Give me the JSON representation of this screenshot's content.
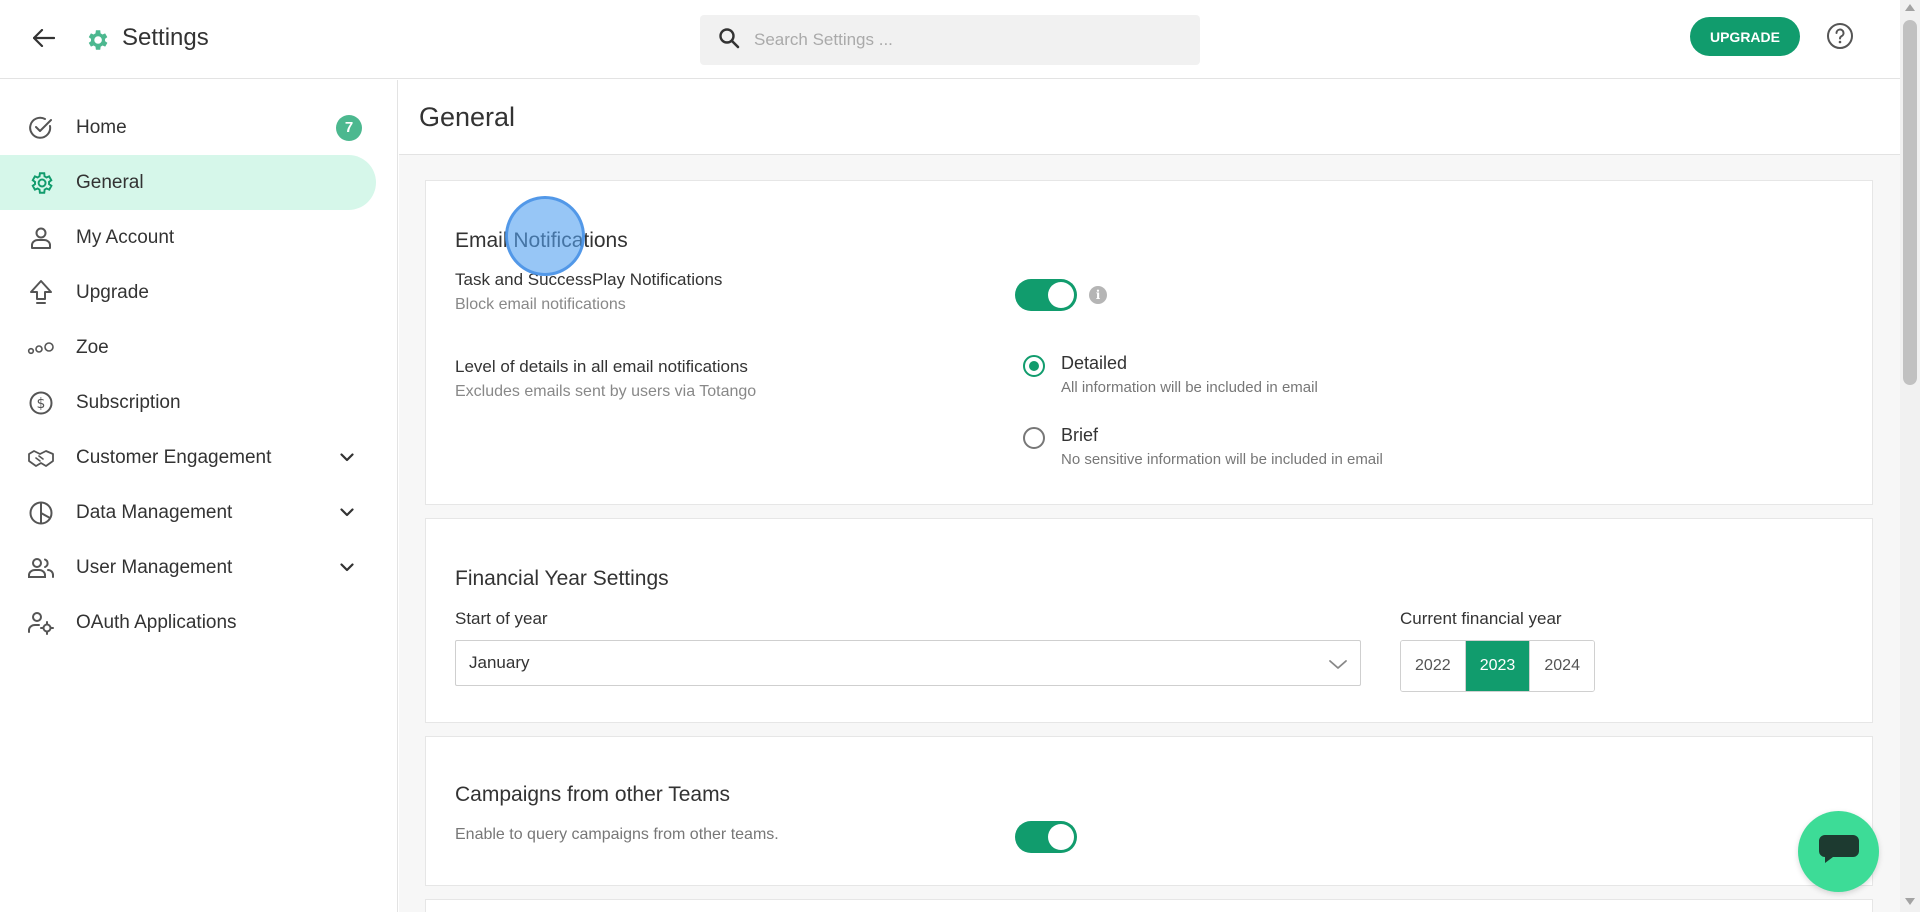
{
  "header": {
    "title": "Settings",
    "search_placeholder": "Search Settings ...",
    "upgrade_label": "UPGRADE"
  },
  "sidebar": {
    "items": [
      {
        "label": "Home",
        "icon": "check-circle-icon",
        "badge": "7"
      },
      {
        "label": "General",
        "icon": "gear-icon",
        "active": true
      },
      {
        "label": "My Account",
        "icon": "person-icon"
      },
      {
        "label": "Upgrade",
        "icon": "upgrade-arrow-icon"
      },
      {
        "label": "Zoe",
        "icon": "dots-icon"
      },
      {
        "label": "Subscription",
        "icon": "dollar-circle-icon"
      },
      {
        "label": "Customer Engagement",
        "icon": "handshake-icon",
        "expandable": true
      },
      {
        "label": "Data Management",
        "icon": "pie-chart-icon",
        "expandable": true
      },
      {
        "label": "User Management",
        "icon": "users-icon",
        "expandable": true
      },
      {
        "label": "OAuth Applications",
        "icon": "user-gear-icon"
      }
    ]
  },
  "main": {
    "page_title": "General",
    "email_notifications": {
      "title": "Email Notifications",
      "task_title": "Task and SuccessPlay Notifications",
      "task_sub": "Block email notifications",
      "task_toggle_on": true,
      "level_title": "Level of details in all email notifications",
      "level_sub": "Excludes emails sent by users via Totango",
      "options": [
        {
          "label": "Detailed",
          "description": "All information will be included in email",
          "checked": true
        },
        {
          "label": "Brief",
          "description": "No sensitive information will be included in email",
          "checked": false
        }
      ]
    },
    "financial_year": {
      "title": "Financial Year Settings",
      "start_label": "Start of year",
      "start_value": "January",
      "current_label": "Current financial year",
      "years": [
        "2022",
        "2023",
        "2024"
      ],
      "selected_year": "2023"
    },
    "campaigns": {
      "title": "Campaigns from other Teams",
      "description": "Enable to query campaigns from other teams.",
      "toggle_on": true
    }
  },
  "colors": {
    "accent": "#119c6d",
    "active_bg": "#d6f7ea",
    "badge": "#4cb88f",
    "chat_fab": "#3ddc97"
  }
}
